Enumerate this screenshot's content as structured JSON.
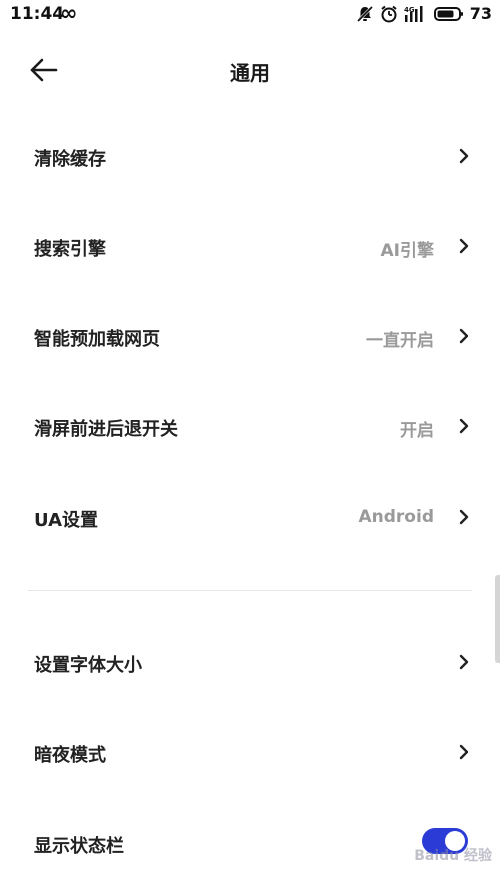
{
  "statusbar": {
    "time": "11:44",
    "infinity_glyph": "∞",
    "signal_label": "4G",
    "battery": "73",
    "icons": [
      "muted-bell-icon",
      "alarm-clock-icon",
      "signal-icon",
      "battery-icon"
    ]
  },
  "header": {
    "title": "通用",
    "back_icon": "arrow-left-icon"
  },
  "settings": [
    {
      "label": "清除缓存",
      "value": ""
    },
    {
      "label": "搜索引擎",
      "value": "AI引擎"
    },
    {
      "label": "智能预加载网页",
      "value": "一直开启"
    },
    {
      "label": "滑屏前进后退开关",
      "value": "开启"
    },
    {
      "label": "UA设置",
      "value": "Android"
    },
    {
      "label": "设置字体大小",
      "value": ""
    },
    {
      "label": "暗夜模式",
      "value": ""
    },
    {
      "label": "显示状态栏",
      "toggle": "on"
    }
  ],
  "colors": {
    "accent": "#2b3bd6",
    "value_text": "#9a9a9a",
    "divider": "#e6e6e6"
  },
  "watermark": "Baidu 经验"
}
